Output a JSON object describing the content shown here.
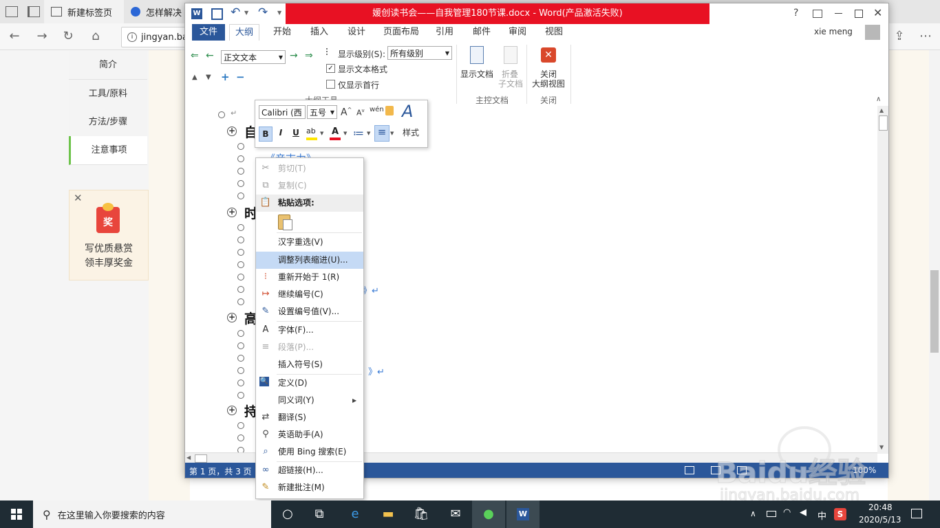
{
  "browser": {
    "tabs": [
      {
        "label": "新建标签页"
      },
      {
        "label": "怎样解决"
      }
    ],
    "address": "jingyan.ba"
  },
  "sidebar": {
    "items": [
      "简介",
      "工具/原料",
      "方法/步骤",
      "注意事项"
    ],
    "promo_line1": "写优质悬赏",
    "promo_line2": "领丰厚奖金",
    "promo_badge": "奖"
  },
  "word": {
    "title": "媛创读书会——自我管理180节课.docx -  Word(产品激活失败)",
    "user": "xie meng",
    "help": "?",
    "tabs": [
      "文件",
      "大纲",
      "开始",
      "插入",
      "设计",
      "页面布局",
      "引用",
      "邮件",
      "审阅",
      "视图"
    ],
    "outline": {
      "level_select": "正文文本",
      "show_level_label": "显示级别(S):",
      "show_level_value": "所有级别",
      "show_text_format": "显示文本格式",
      "first_line_only": "仅显示首行",
      "group_label": "大纲工具"
    },
    "master": {
      "show_doc": "显示文档",
      "collapse": "折叠",
      "subdoc": "子文档",
      "group_label": "主控文档"
    },
    "close": {
      "label1": "关闭",
      "label2": "大纲视图",
      "group_label": "关闭"
    },
    "status": {
      "page": "第 1 页，共 3 页",
      "zoom": "100%"
    },
    "doc": {
      "headings": [
        "自",
        "时",
        "高",
        "持"
      ],
      "item1_link": "《音志力》",
      "fragment1": "》↵",
      "fragment2": "》↵"
    }
  },
  "mini_toolbar": {
    "font": "Calibri (西",
    "size": "五号",
    "styles_label": "样式",
    "bold": "B",
    "italic": "I",
    "underline": "U",
    "font_color": "A"
  },
  "context_menu": {
    "items": [
      {
        "label": "剪切(T)",
        "icon": "scissors-icon",
        "disabled": true
      },
      {
        "label": "复制(C)",
        "icon": "copy-icon",
        "disabled": true
      },
      {
        "label": "粘贴选项:",
        "icon": "paste-icon",
        "disabled": false
      },
      {
        "label": "汉字重选(V)",
        "icon": "",
        "disabled": false
      },
      {
        "label": "调整列表缩进(U)...",
        "icon": "",
        "disabled": false
      },
      {
        "label": "重新开始于 1(R)",
        "icon": "restart-numbering-icon",
        "disabled": false
      },
      {
        "label": "继续编号(C)",
        "icon": "continue-numbering-icon",
        "disabled": false
      },
      {
        "label": "设置编号值(V)...",
        "icon": "set-number-icon",
        "disabled": false
      },
      {
        "label": "字体(F)...",
        "icon": "font-icon",
        "disabled": false
      },
      {
        "label": "段落(P)...",
        "icon": "paragraph-icon",
        "disabled": true
      },
      {
        "label": "插入符号(S)",
        "icon": "",
        "disabled": false
      },
      {
        "label": "定义(D)",
        "icon": "define-icon",
        "disabled": false
      },
      {
        "label": "同义词(Y)",
        "icon": "",
        "disabled": false
      },
      {
        "label": "翻译(S)",
        "icon": "translate-icon",
        "disabled": false
      },
      {
        "label": "英语助手(A)",
        "icon": "english-assistant-icon",
        "disabled": false
      },
      {
        "label": "使用 Bing 搜索(E)",
        "icon": "bing-search-icon",
        "disabled": false
      },
      {
        "label": "超链接(H)...",
        "icon": "hyperlink-icon",
        "disabled": false
      },
      {
        "label": "新建批注(M)",
        "icon": "comment-icon",
        "disabled": false
      }
    ]
  },
  "taskbar": {
    "search_placeholder": "在这里输入你要搜索的内容",
    "time": "20:48",
    "date": "2020/5/13",
    "ime": "中"
  },
  "watermark": {
    "brand": "Baidu经验",
    "url": "jingyan.baidu.com"
  }
}
